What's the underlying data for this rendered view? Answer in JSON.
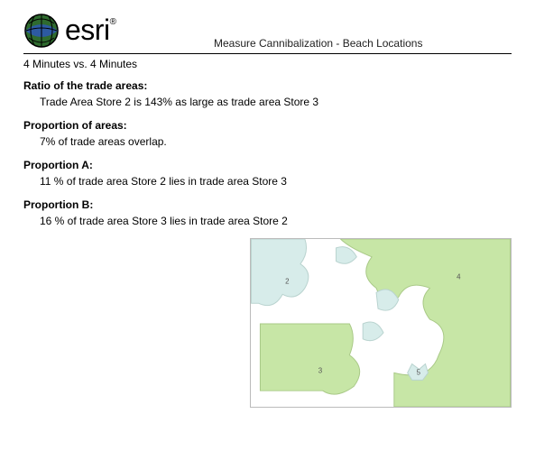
{
  "brand": {
    "name": "esri",
    "trademark": "®"
  },
  "doc_title": "Measure Cannibalization - Beach Locations",
  "subhead": "4 Minutes vs. 4 Minutes",
  "sections": {
    "ratio": {
      "label": "Ratio of the trade areas:",
      "body": "Trade Area Store 2 is 143%  as large as trade area Store 3"
    },
    "proportion_areas": {
      "label": "Proportion of areas:",
      "body": "7% of trade areas overlap."
    },
    "proportion_a": {
      "label": "Proportion A:",
      "body": "11 % of trade area Store 2 lies in trade area Store 3"
    },
    "proportion_b": {
      "label": "Proportion B:",
      "body": "16 % of trade area Store 3 lies in trade area Store 2"
    }
  },
  "map": {
    "region_labels": [
      "2",
      "3",
      "4",
      "5"
    ]
  }
}
